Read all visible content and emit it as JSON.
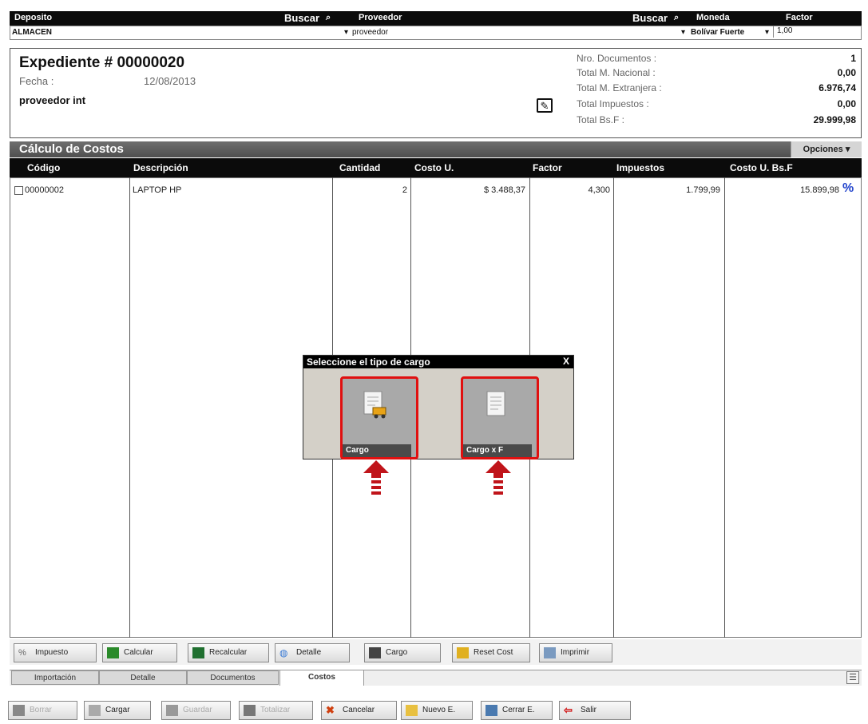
{
  "header": {
    "deposito_label": "Deposito",
    "buscar1": "Buscar",
    "proveedor_label": "Proveedor",
    "buscar2": "Buscar",
    "moneda_label": "Moneda",
    "factor_label": "Factor",
    "deposito_value": "ALMACEN",
    "proveedor_value": "proveedor",
    "moneda_value": "Bolívar Fuerte",
    "factor_value": "1,00"
  },
  "summary": {
    "title": "Expediente # 00000020",
    "fecha_label": "Fecha :",
    "fecha_value": "12/08/2013",
    "proveedor": "proveedor int",
    "rows": [
      {
        "label": "Nro. Documentos :",
        "value": "1"
      },
      {
        "label": "Total M. Nacional :",
        "value": "0,00"
      },
      {
        "label": "Total M. Extranjera :",
        "value": "6.976,74"
      },
      {
        "label": "Total Impuestos :",
        "value": "0,00"
      },
      {
        "label": "Total Bs.F :",
        "value": "29.999,98"
      }
    ]
  },
  "section": {
    "title": "Cálculo de Costos",
    "opciones": "Opciones"
  },
  "grid": {
    "columns": [
      "Código",
      "Descripción",
      "Cantidad",
      "Costo U.",
      "Factor",
      "Impuestos",
      "Costo U. Bs.F"
    ],
    "rows": [
      {
        "codigo": "00000002",
        "descripcion": "LAPTOP HP",
        "cantidad": "2",
        "costo": "$ 3.488,37",
        "factor": "4,300",
        "impuestos": "1.799,99",
        "costo_bs": "15.899,98"
      }
    ]
  },
  "dialog": {
    "title": "Seleccione el tipo de cargo",
    "close": "X",
    "btn1": "Cargo",
    "btn2": "Cargo x F"
  },
  "toolbar": [
    "Impuesto",
    "Calcular",
    "Recalcular",
    "Detalle",
    "Cargo",
    "Reset Cost",
    "Imprimir"
  ],
  "tabs": [
    "Importación",
    "Detalle",
    "Documentos",
    "Costos"
  ],
  "bottom": [
    "Borrar",
    "Cargar",
    "Guardar",
    "Totalizar",
    "Cancelar",
    "Nuevo E.",
    "Cerrar E.",
    "Salir"
  ]
}
